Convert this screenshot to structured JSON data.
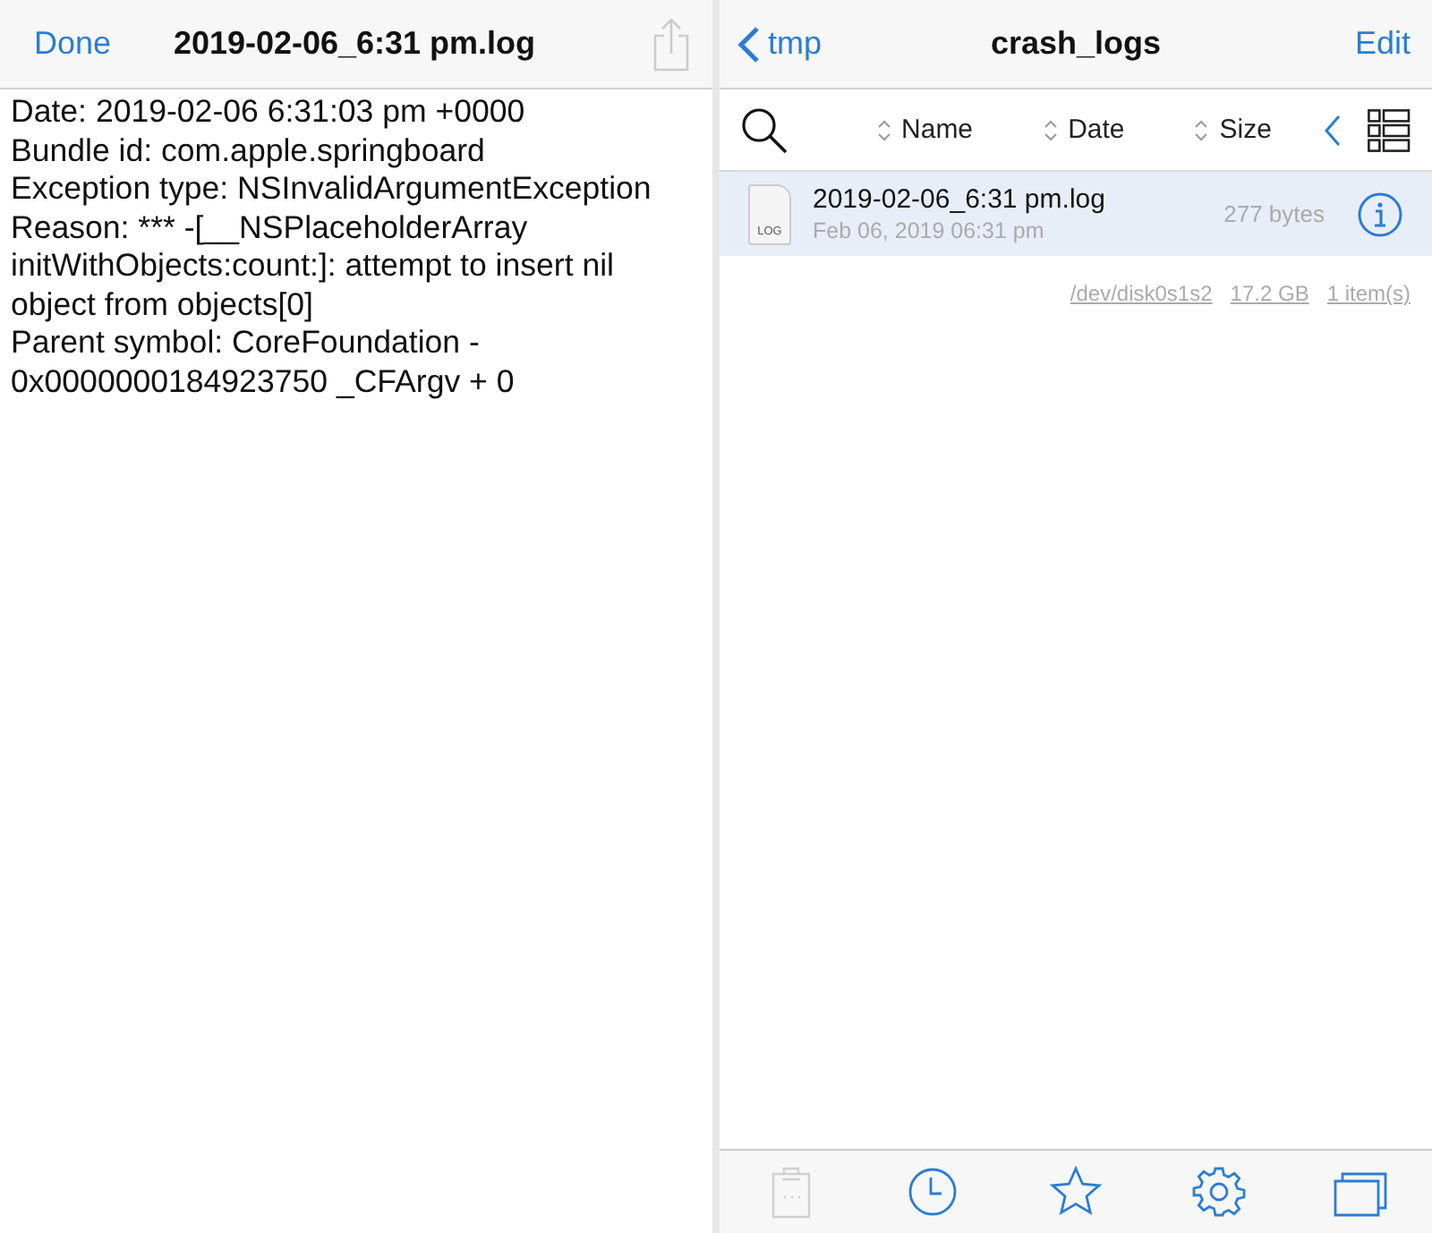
{
  "viewer": {
    "done": "Done",
    "title": "2019-02-06_6:31 pm.log",
    "share_disabled": true,
    "lines": [
      "Date: 2019-02-06 6:31:03 pm +0000",
      "Bundle id: com.apple.springboard",
      "Exception type: NSInvalidArgumentException",
      "Reason: *** -[__NSPlaceholderArray initWithObjects:count:]: attempt to insert nil object from objects[0]",
      "Parent symbol: CoreFoundation - 0x0000000184923750 _CFArgv + 0"
    ]
  },
  "browser": {
    "back": "tmp",
    "title": "crash_logs",
    "edit": "Edit",
    "sort_columns": [
      "Name",
      "Date",
      "Size"
    ],
    "files": [
      {
        "name": "2019-02-06_6:31 pm.log",
        "date": "Feb 06, 2019 06:31 pm",
        "size": "277 bytes",
        "icon_label": "LOG",
        "selected": true
      }
    ],
    "footer": [
      "/dev/disk0s1s2",
      "17.2 GB",
      "1 item(s)"
    ],
    "tabs": [
      {
        "kind": "clipboard",
        "disabled": true
      },
      {
        "kind": "clock",
        "disabled": false
      },
      {
        "kind": "star",
        "disabled": false
      },
      {
        "kind": "gear",
        "disabled": false
      },
      {
        "kind": "windows",
        "disabled": false
      }
    ]
  }
}
